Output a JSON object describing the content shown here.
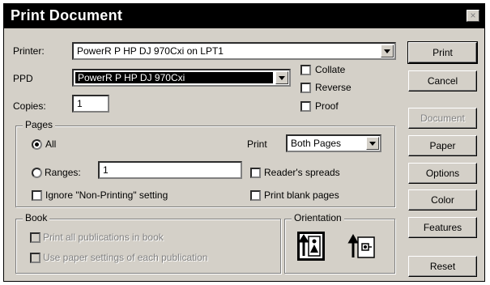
{
  "window": {
    "title": "Print Document",
    "close_glyph": "×"
  },
  "printer": {
    "label": "Printer:",
    "value": "PowerR P HP DJ 970Cxi on LPT1"
  },
  "ppd": {
    "label": "PPD",
    "value": "PowerR P HP DJ 970Cxi"
  },
  "copies": {
    "label": "Copies:",
    "value": "1"
  },
  "options": {
    "collate": "Collate",
    "reverse": "Reverse",
    "proof": "Proof"
  },
  "pages": {
    "title": "Pages",
    "all_label": "All",
    "ranges_label": "Ranges:",
    "ranges_value": "1",
    "ignore_label": "Ignore \"Non-Printing\" setting",
    "print_label": "Print",
    "print_select": "Both Pages",
    "readers_label": "Reader's spreads",
    "blank_label": "Print blank pages"
  },
  "book": {
    "title": "Book",
    "print_all": "Print all publications in book",
    "use_paper": "Use paper settings of each publication"
  },
  "orientation": {
    "title": "Orientation",
    "portrait_icon": "portrait-orientation-icon",
    "landscape_icon": "landscape-orientation-icon"
  },
  "buttons": {
    "print": "Print",
    "cancel": "Cancel",
    "document": "Document",
    "paper": "Paper",
    "options": "Options",
    "color": "Color",
    "features": "Features",
    "reset": "Reset"
  }
}
